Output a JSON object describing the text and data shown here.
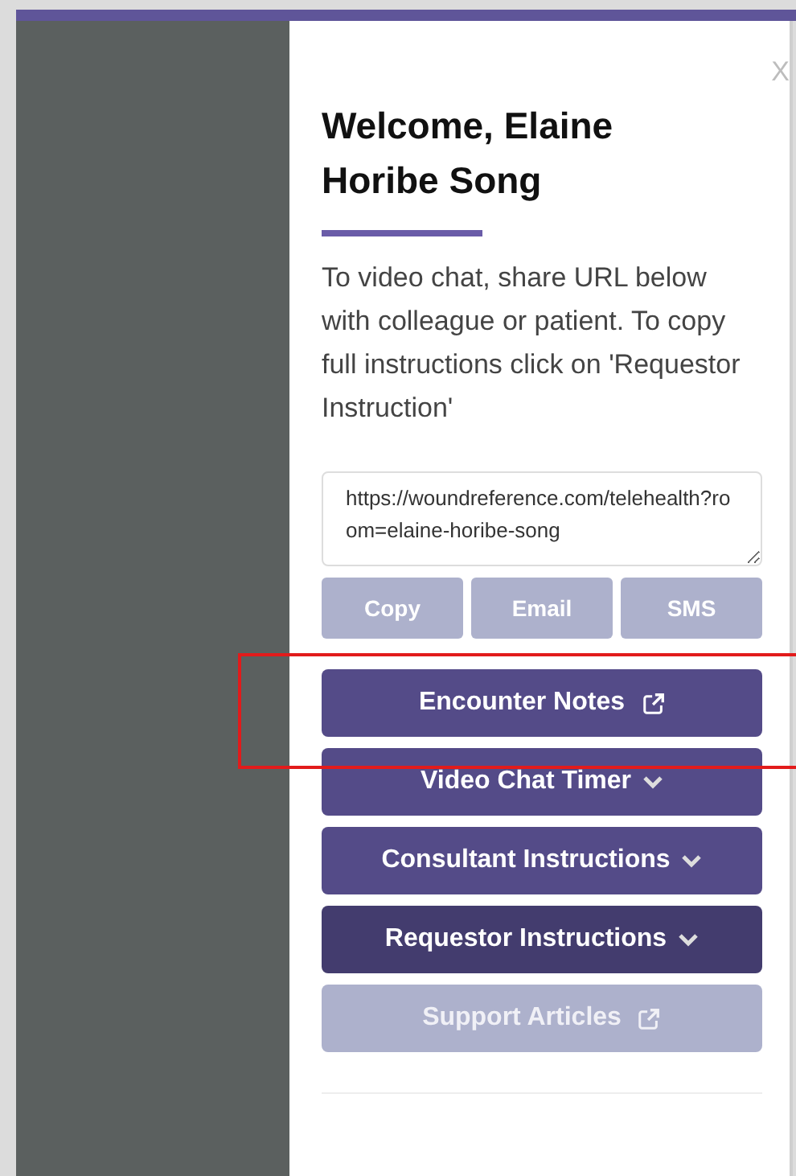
{
  "panel": {
    "close": "X",
    "title": "Welcome, Elaine Horibe Song",
    "intro": "To video chat, share URL below with colleague or patient. To copy full instructions click on 'Requestor Instruction'",
    "url_field": {
      "value": "https://woundreference.com/telehealth?room=elaine-horibe-song"
    },
    "share_buttons": [
      {
        "label": "Copy"
      },
      {
        "label": "Email"
      },
      {
        "label": "SMS"
      }
    ],
    "menu_buttons": [
      {
        "label": "Encounter Notes",
        "kind": "link",
        "selected": false,
        "disabled": false,
        "highlighted": true
      },
      {
        "label": "Video Chat Timer",
        "kind": "dropdown",
        "selected": false,
        "disabled": false,
        "highlighted": false
      },
      {
        "label": "Consultant Instructions",
        "kind": "dropdown",
        "selected": false,
        "disabled": false,
        "highlighted": false
      },
      {
        "label": "Requestor Instructions",
        "kind": "dropdown",
        "selected": true,
        "disabled": false,
        "highlighted": false
      },
      {
        "label": "Support Articles",
        "kind": "link",
        "selected": false,
        "disabled": true,
        "highlighted": false
      }
    ]
  }
}
